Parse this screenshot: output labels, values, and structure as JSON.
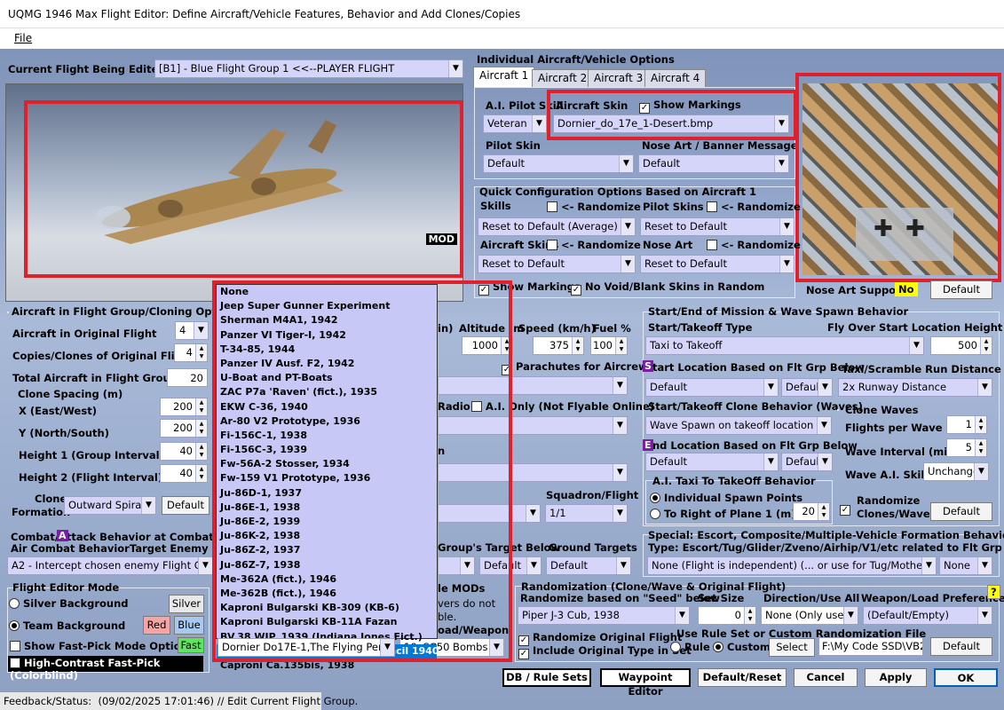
{
  "window": {
    "title": "UQMG 1946 Max Flight Editor:  Define Aircraft/Vehicle Features, Behavior and Add Clones/Copies"
  },
  "menu": {
    "file": "File"
  },
  "flight": {
    "label": "Current Flight Being Edited:",
    "value": "[B1] - Blue Flight Group  1     <<--PLAYER FLIGHT",
    "mod_badge": "MOD"
  },
  "indiv": {
    "title": "Individual Aircraft/Vehicle Options",
    "tabs": [
      "Aircraft 1",
      "Aircraft 2",
      "Aircraft 3",
      "Aircraft 4"
    ],
    "ai_skill_label": "A.I. Pilot Skill",
    "ai_skill": "Veteran",
    "skin_label": "Aircraft Skin",
    "show_markings": "Show Markings",
    "skin_value": "Dornier_do_17e_1-Desert.bmp",
    "pilot_skin_label": "Pilot Skin",
    "pilot_skin": "Default",
    "nose_label": "Nose Art / Banner Message",
    "nose_value": "Default"
  },
  "quick": {
    "title": "Quick Configuration Options Based on Aircraft 1",
    "skills": "Skills",
    "randomize": "<- Randomize",
    "pilot_skins": "Pilot Skins",
    "reset_avg": "Reset to Default (Average)",
    "reset": "Reset to Default",
    "aircraft_skins": "Aircraft Skins",
    "nose_art": "Nose Art",
    "show_markings": "Show Markings",
    "no_void": "No Void/Blank Skins in Random"
  },
  "nose_support": {
    "label": "Nose Art Support:",
    "value": "No",
    "default": "Default"
  },
  "cloning": {
    "title": "Aircraft in Flight Group/Cloning Options",
    "in_orig": "Aircraft in Original Flight",
    "in_orig_val": "4",
    "copies": "Copies/Clones of Original Flight",
    "copies_val": "4",
    "total": "Total Aircraft in Flight Group",
    "total_val": "20",
    "spacing": "Clone Spacing (m)",
    "x": "X (East/West)",
    "x_val": "200",
    "y": "Y (North/South)",
    "y_val": "200",
    "h1": "Height 1 (Group Interval)",
    "h1_val": "40",
    "h2": "Height 2 (Flight Interval)",
    "h2_val": "40",
    "clone_lbl": "Clone",
    "formation_lbl": "Formation",
    "formation": "Outward Spira",
    "default": "Default"
  },
  "middle": {
    "min": "in)",
    "altitude": "Altitude (m",
    "speed": "Speed (km/h)",
    "fuel": "Fuel %",
    "alt_val": "1000",
    "speed_val": "375",
    "fuel_val": "100",
    "parachutes": "Parachutes for Aircrew",
    "radio": "Radio",
    "ai_only": "A.I. Only (Not Flyable Online)",
    "n": "n",
    "squadron": "Squadron/Flight",
    "squadron_val": "1/1",
    "grp_target": "Group's Target Below",
    "ground": "Ground Targets",
    "default": "Default",
    "mods": "le MODs",
    "vers": "vers do not",
    "ble": "ble.",
    "load": "oad/Weapon"
  },
  "dropdown": {
    "items": [
      "None",
      "Jeep Super Gunner Experiment",
      "Sherman M4A1, 1942",
      "Panzer VI Tiger-I, 1942",
      "T-34-85, 1944",
      "Panzer IV Ausf. F2, 1942",
      "U-Boat and PT-Boats",
      "ZAC P7a 'Raven' (fict.), 1935",
      "EKW C-36, 1940",
      "Ar-80 V2 Prototype, 1936",
      "Fi-156C-1, 1938",
      "Fi-156C-3, 1939",
      "Fw-56A-2 Stosser, 1934",
      "Fw-159 V1 Prototype, 1936",
      "Ju-86D-1, 1937",
      "Ju-86E-1, 1938",
      "Ju-86E-2, 1939",
      "Ju-86K-2, 1938",
      "Ju-86Z-2, 1937",
      "Ju-86Z-7, 1938",
      "Me-362A (fict.), 1946",
      "Me-362B (fict.), 1946",
      "Kaproni Bulgarski KB-309 (KB-6)",
      "Kaproni Bulgarski KB-11A Fazan",
      "BV.38 WIP, 1939 (Indiana Jones Fict.)",
      "Dornier Do17E-1,The Flying Pencil 1940",
      "Caproni Ca.135bis, 1938"
    ],
    "selected": "Dornier Do17E-1,The Flying Penc",
    "weapon": "10xSC50 Bombs"
  },
  "combat": {
    "title": "Combat/Attack Behavior at Combat Zon",
    "air": "Air Combat Behavior",
    "target": "Target Enemy Flt",
    "value": "A2 - Intercept chosen enemy Flight G"
  },
  "mode": {
    "title": "Flight Editor Mode",
    "silver_bg": "Silver Background",
    "silver": "Silver",
    "team_bg": "Team Background",
    "red": "Red",
    "blue": "Blue",
    "fast_pick": "Show Fast-Pick Mode Options",
    "fast": "Fast",
    "hc": "High-Contrast Fast-Pick (Colorblind)"
  },
  "spawn": {
    "title": "Start/End of Mission & Wave Spawn Behavior",
    "start_type": "Start/Takeoff Type",
    "flyover": "Fly Over Start Location Height (m)",
    "start_val": "Taxi to Takeoff",
    "flyover_val": "500",
    "start_loc": "tart Location Based on Flt Grp Below",
    "taxi_dist": "Taxi/Scramble Run Distance",
    "default": "Default",
    "defaul": "Defaul",
    "taxi_val": "2x Runway Distance",
    "clone_beh": "Start/Takeoff Clone Behavior (Waves)",
    "wave_spawn": "Wave Spawn on takeoff location (F",
    "clone_waves": "Clone Waves",
    "fpw": "Flights per Wave",
    "fpw_val": "1",
    "end_loc": "nd Location Based on Flt Grp Below",
    "wave_int": "Wave Interval (min)",
    "wave_int_val": "5",
    "wave_skill": "Wave A.I. Skills",
    "wave_skill_val": "Unchange",
    "ai_taxi": "A.I. Taxi To TakeOff Behavior",
    "indiv_spawn": "Individual Spawn Points",
    "right_of": "To Right of Plane 1 (m) ->",
    "right_val": "20",
    "randomize": "Randomize",
    "clones_waves": "Clones/Waves",
    "s_letter": "S",
    "e_letter": "E"
  },
  "special": {
    "title": "Special: Escort, Composite/Multiple-Vehicle Formation Behavior",
    "type": "Type: Escort/Tug/Glider/Zveno/Airhip/V1/etc related to Flt Grp Below",
    "value": "None (Flight is independent) (... or use for Tug/Mothersl",
    "none": "None"
  },
  "random": {
    "title": "Randomization (Clone/Wave & Original Flight)",
    "seed": "Randomize based on \"Seed\" below",
    "set_size": "Set Size",
    "direction": "Direction/Use All",
    "weapon_pref": "Weapon/Load Preference",
    "help": "?",
    "seed_val": "Piper J-3 Cub, 1938",
    "set_val": "0",
    "dir_val": "None (Only use",
    "weapon_val": "(Default/Empty)",
    "rand_orig": "Randomize Original Flight",
    "incl_orig": "Include Original Type in Set",
    "rule_title": "Use Rule Set or Custom Randomization File",
    "rule": "Rule",
    "custom": "Custom",
    "select": "Select",
    "path": "F:\\My Code SSD\\VB2",
    "default": "Default"
  },
  "buttons": {
    "db": "DB / Rule Sets",
    "waypoint": "Waypoint Editor",
    "reset": "Default/Reset",
    "cancel": "Cancel",
    "apply": "Apply",
    "ok": "OK"
  },
  "status": {
    "label": "Feedback/Status:",
    "text": "(09/02/2025 17:01:46) // Edit Current Flight Group."
  },
  "colors": {
    "highlight": "#e0202c",
    "combo": "#d5d5f9",
    "select": "#0078d7"
  }
}
